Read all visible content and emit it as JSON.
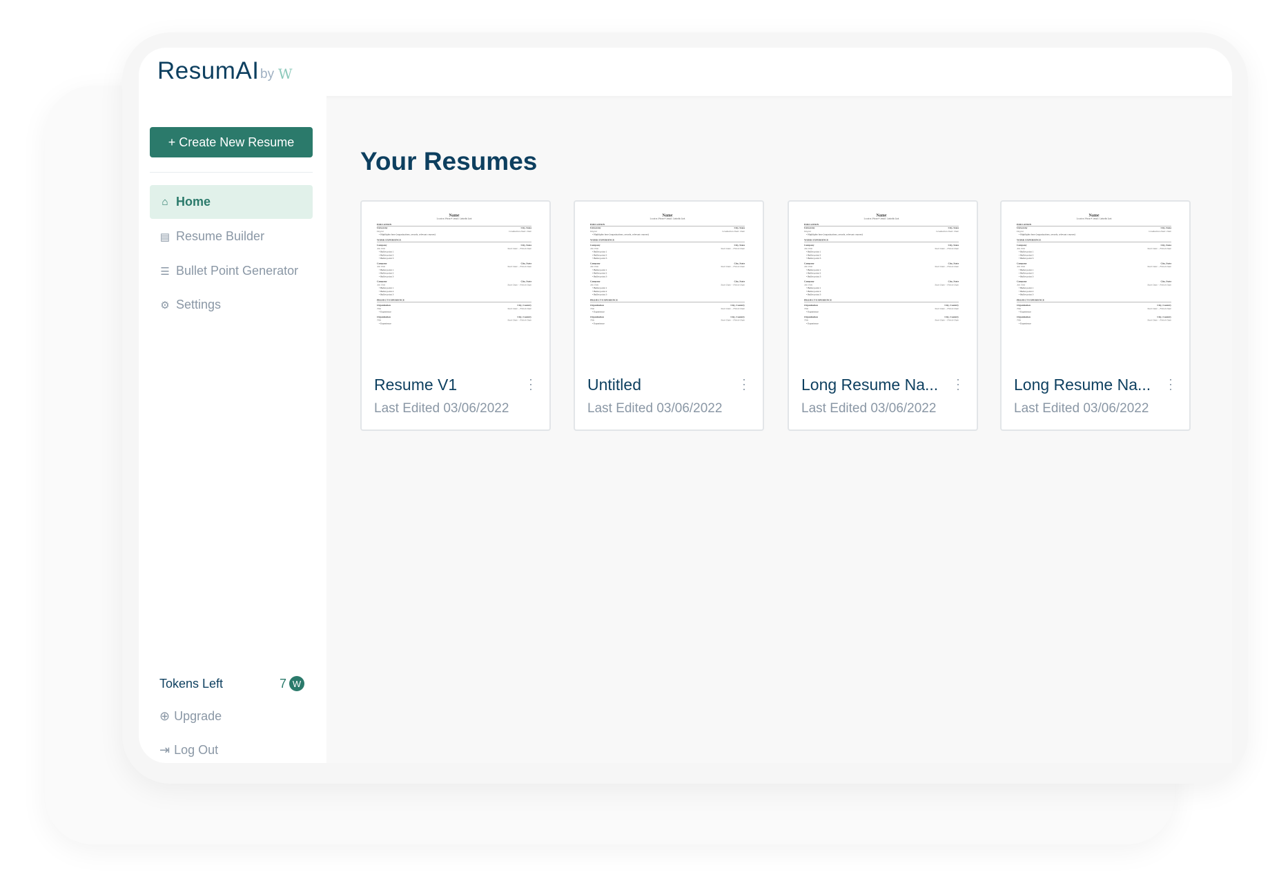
{
  "header": {
    "logo": "ResumAI",
    "by": "by",
    "brand_mark": "W"
  },
  "sidebar": {
    "create_button": "+ Create New Resume",
    "items": [
      {
        "label": "Home",
        "icon": "home-icon"
      },
      {
        "label": "Resume Builder",
        "icon": "document-icon"
      },
      {
        "label": "Bullet Point Generator",
        "icon": "list-icon"
      },
      {
        "label": "Settings",
        "icon": "gear-icon"
      }
    ],
    "tokens_label": "Tokens Left",
    "tokens_value": "7",
    "token_badge": "W",
    "upgrade": "Upgrade",
    "logout": "Log Out"
  },
  "main": {
    "title": "Your Resumes",
    "cards": [
      {
        "title": "Resume V1",
        "date": "Last Edited 03/06/2022"
      },
      {
        "title": "Untitled",
        "date": "Last Edited 03/06/2022"
      },
      {
        "title": "Long Resume Na...",
        "date": "Last Edited 03/06/2022"
      },
      {
        "title": "Long Resume Na...",
        "date": "Last Edited 03/06/2022"
      }
    ]
  },
  "thumbnail": {
    "name": "Name",
    "contact": "Location | Phone # | email | LinkedIn Link",
    "education": "EDUCATION",
    "university": "University",
    "city_state": "City, State",
    "degree": "Degree",
    "grad": "Graduation Date: Date",
    "highlights": "Highlights here (organizations, awards, relevant courses)",
    "work": "WORK EXPERIENCE",
    "company": "Company",
    "job_title": "Job Title",
    "dates": "Start Date – Finish Date",
    "bullets": [
      "Bullet point 1",
      "Bullet point 2",
      "Bullet point 3"
    ],
    "project": "PROJECT EXPERIENCE",
    "organization": "Organization",
    "city_country": "City, Country",
    "proj_title": "Title",
    "experience": "Experience"
  },
  "colors": {
    "primary": "#2b7a6b",
    "navy": "#0d3f5f",
    "muted": "#8a97a5",
    "active_bg": "#e1f1ea"
  }
}
